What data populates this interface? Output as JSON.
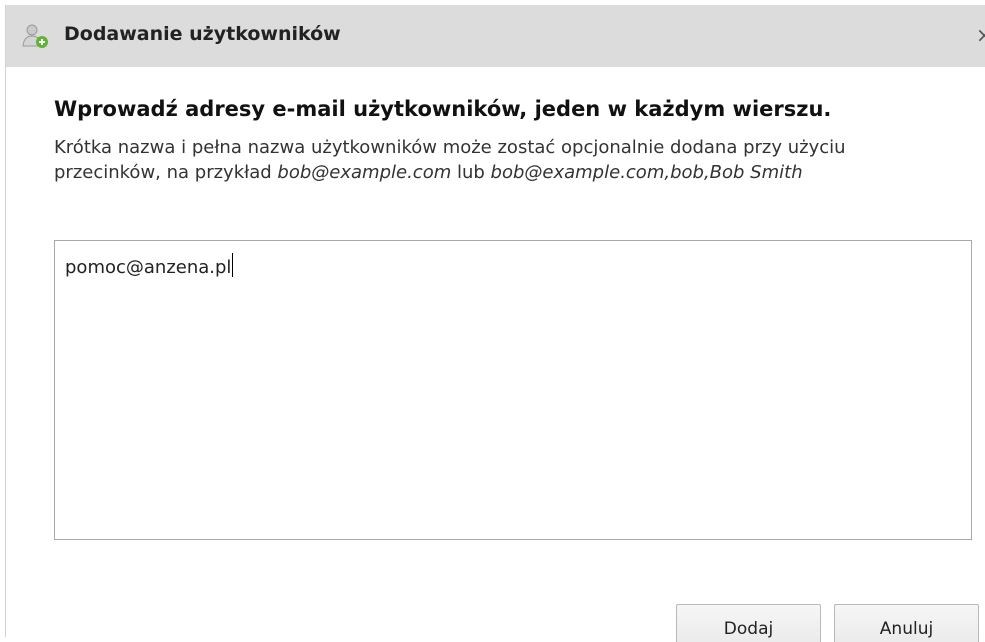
{
  "dialog": {
    "title": "Dodawanie użytkowników",
    "title_icon": "add-user-icon",
    "close_glyph": "×"
  },
  "content": {
    "heading": "Wprowadź adresy e-mail użytkowników, jeden w każdym wierszu.",
    "description_part1": "Krótka nazwa i pełna nazwa użytkowników może zostać opcjonalnie dodana przy użyciu przecinków, na przykład ",
    "example1": "bob@example.com",
    "description_part2": " lub ",
    "example2": "bob@example.com,bob,Bob Smith"
  },
  "input": {
    "value": "pomoc@anzena.pl"
  },
  "buttons": {
    "add_label": "Dodaj",
    "cancel_label": "Anuluj"
  }
}
